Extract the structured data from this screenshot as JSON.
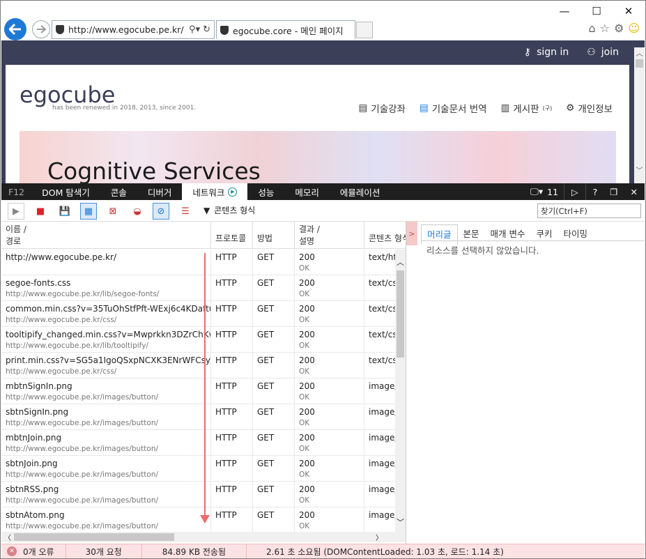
{
  "browser": {
    "url": "http://www.egocube.pe.kr/",
    "tab_title": "egocube.core - 메인 페이지"
  },
  "site": {
    "signin": "sign in",
    "join": "join",
    "logo": "egocube",
    "tagline": "has been renewed in 2018, 2013, since 2001.",
    "nav": [
      "기술강좌",
      "기술문서 번역",
      "게시판",
      "개인정보"
    ],
    "nav_sup": "(구)",
    "hero_heading": "Cognitive Services"
  },
  "f12": {
    "label": "F12",
    "tabs": [
      "DOM 탐색기",
      "콘솔",
      "디버거",
      "네트워크",
      "성능",
      "메모리",
      "에뮬레이션"
    ],
    "count": "11"
  },
  "toolbar": {
    "content_type": "콘텐츠 형식",
    "find_placeholder": "찾기(Ctrl+F)"
  },
  "grid": {
    "headers": {
      "name": "이름 /",
      "path": "경로",
      "protocol": "프로토콜",
      "method": "방법",
      "result": "결과 /",
      "desc": "설명",
      "ctype": "콘텐츠 형식"
    },
    "rows": [
      {
        "name": "http://www.egocube.pe.kr/",
        "path": "",
        "protocol": "HTTP",
        "method": "GET",
        "code": "200",
        "status": "OK",
        "type": "text/html"
      },
      {
        "name": "segoe-fonts.css",
        "path": "http://www.egocube.pe.kr/lib/segoe-fonts/",
        "protocol": "HTTP",
        "method": "GET",
        "code": "200",
        "status": "OK",
        "type": "text/css"
      },
      {
        "name": "common.min.css?v=35TuOhStfPft-WExj6c4KDaftuD...",
        "path": "http://www.egocube.pe.kr/css/",
        "protocol": "HTTP",
        "method": "GET",
        "code": "200",
        "status": "OK",
        "type": "text/css"
      },
      {
        "name": "tooltipify_changed.min.css?v=Mwprkkn3DZrChKwZ...",
        "path": "http://www.egocube.pe.kr/lib/tooltipify/",
        "protocol": "HTTP",
        "method": "GET",
        "code": "200",
        "status": "OK",
        "type": "text/css"
      },
      {
        "name": "print.min.css?v=SG5a1IgoQSxpNCXK3ENrWFCsybV...",
        "path": "http://www.egocube.pe.kr/css/",
        "protocol": "HTTP",
        "method": "GET",
        "code": "200",
        "status": "OK",
        "type": "text/css"
      },
      {
        "name": "mbtnSignIn.png",
        "path": "http://www.egocube.pe.kr/images/button/",
        "protocol": "HTTP",
        "method": "GET",
        "code": "200",
        "status": "OK",
        "type": "image/"
      },
      {
        "name": "sbtnSignIn.png",
        "path": "http://www.egocube.pe.kr/images/button/",
        "protocol": "HTTP",
        "method": "GET",
        "code": "200",
        "status": "OK",
        "type": "image/"
      },
      {
        "name": "mbtnJoin.png",
        "path": "http://www.egocube.pe.kr/images/button/",
        "protocol": "HTTP",
        "method": "GET",
        "code": "200",
        "status": "OK",
        "type": "image/"
      },
      {
        "name": "sbtnJoin.png",
        "path": "http://www.egocube.pe.kr/images/button/",
        "protocol": "HTTP",
        "method": "GET",
        "code": "200",
        "status": "OK",
        "type": "image/"
      },
      {
        "name": "sbtnRSS.png",
        "path": "http://www.egocube.pe.kr/images/button/",
        "protocol": "HTTP",
        "method": "GET",
        "code": "200",
        "status": "OK",
        "type": "image/"
      },
      {
        "name": "sbtnAtom.png",
        "path": "http://www.egocube.pe.kr/images/button/",
        "protocol": "HTTP",
        "method": "GET",
        "code": "200",
        "status": "OK",
        "type": "image/"
      }
    ]
  },
  "details": {
    "tabs": [
      "머리글",
      "본문",
      "매개 변수",
      "쿠키",
      "타이밍"
    ],
    "empty_message": "리소스를 선택하지 않았습니다."
  },
  "status": {
    "errors": "0개 오류",
    "requests": "30개 요청",
    "transferred": "84.89 KB 전송됨",
    "timing": "2.61 초 소요됨 (DOMContentLoaded: 1.03 초, 로드: 1.14 초)"
  },
  "colors": {
    "accent": "#1e78d6",
    "site_header": "#3b3f58",
    "devtools_bar": "#1f1f1f",
    "status_bg": "#fde2e4",
    "annotation_red": "#ec6b6b"
  }
}
